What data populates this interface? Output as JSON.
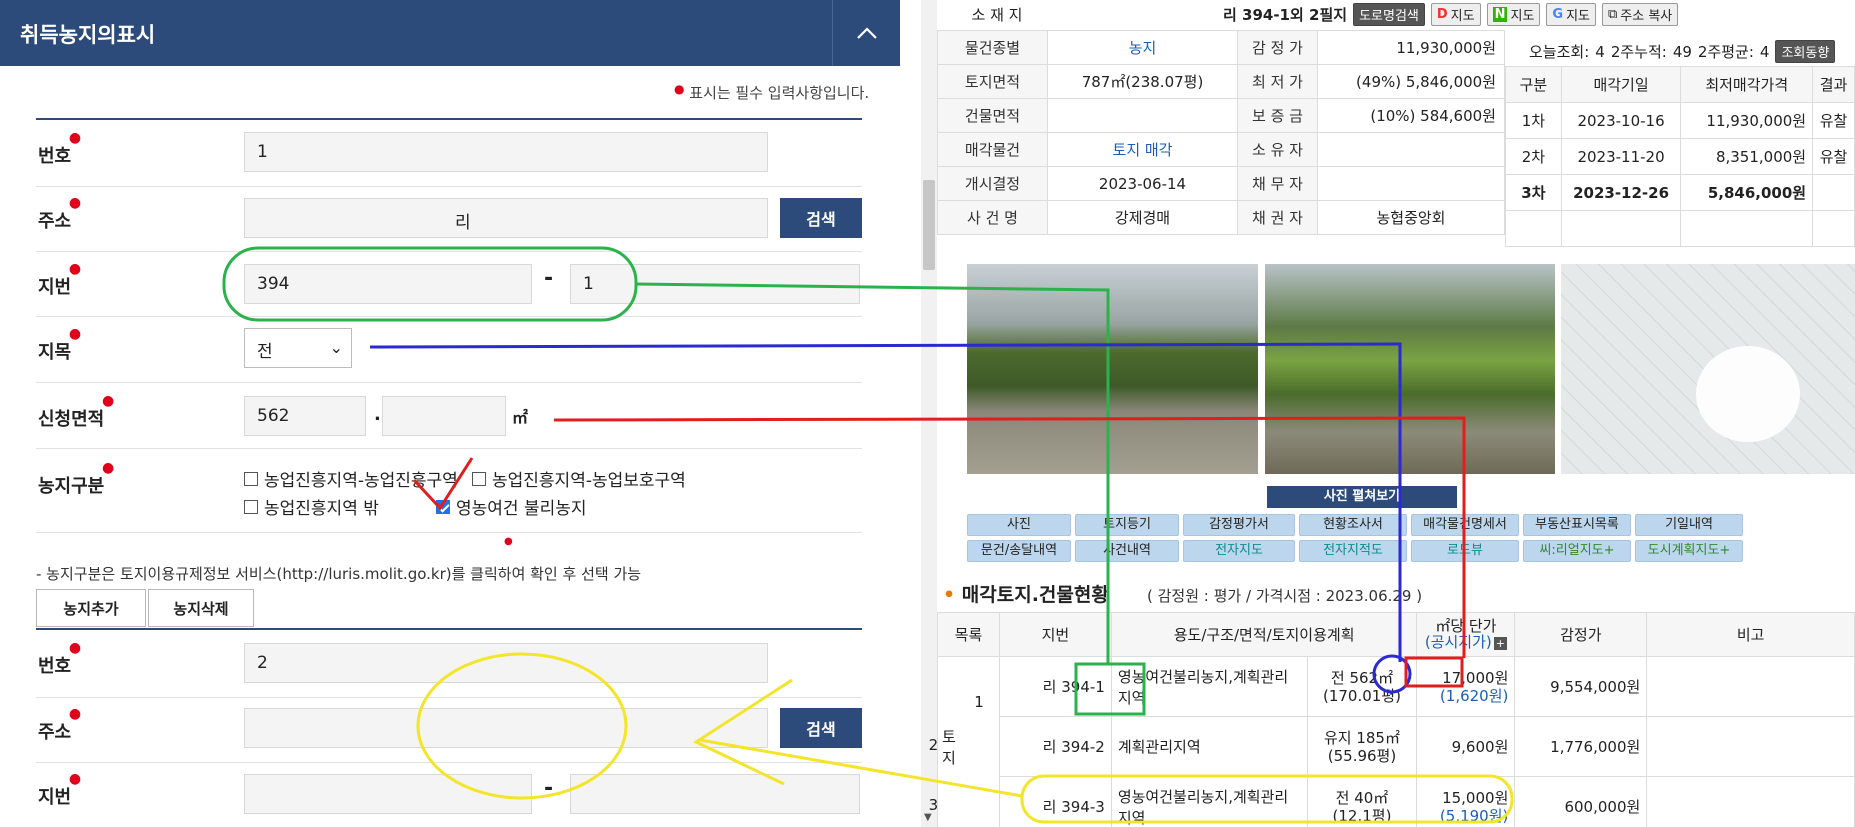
{
  "left": {
    "header_title": "취득농지의표시",
    "required_note": "표시는 필수 입력사항입니다.",
    "fields": {
      "no_label": "번호",
      "address_label": "주소",
      "lot_label": "지번",
      "category_label": "지목",
      "area_label": "신청면적",
      "zone_label": "농지구분"
    },
    "entry1": {
      "no": "1",
      "address": "리",
      "lot_main": "394",
      "lot_sub": "1",
      "category": "전",
      "area_main": "562",
      "area_sub": "",
      "area_unit": "㎡"
    },
    "search_button": "검색",
    "dash": "-",
    "dot": ".",
    "zone_options": [
      {
        "label": "농업진흥지역-농업진흥구역",
        "checked": false
      },
      {
        "label": "농업진흥지역-농업보호구역",
        "checked": false
      },
      {
        "label": "농업진흥지역 밖",
        "checked": false
      },
      {
        "label": "영농여건 불리농지",
        "checked": true
      }
    ],
    "zone_note": "- 농지구분은 토지이용규제정보 서비스(http://luris.molit.go.kr)를 클릭하여 확인 후 선택 가능",
    "add_button": "농지추가",
    "delete_button": "농지삭제",
    "entry2": {
      "no": "2",
      "address": "",
      "lot_main": "",
      "lot_sub": ""
    }
  },
  "right": {
    "address_label": "소 재 지",
    "address_value": "리 394-1외 2필지",
    "addr_buttons": [
      "도로명검색",
      "지도",
      "지도",
      "지도",
      "주소 복사"
    ],
    "info": {
      "type_label": "물건종별",
      "type_value": "농지",
      "appraisal_label": "감 정 가",
      "appraisal_value": "11,930,000원",
      "land_area_label": "토지면적",
      "land_area_value": "787㎡(238.07평)",
      "min_price_label": "최 저 가",
      "min_price_value": "(49%) 5,846,000원",
      "bldg_area_label": "건물면적",
      "bldg_area_value": "",
      "deposit_label": "보 증 금",
      "deposit_value": "(10%) 584,600원",
      "sale_item_label": "매각물건",
      "sale_item_value": "토지 매각",
      "owner_label": "소 유 자",
      "owner_value": "",
      "start_label": "개시결정",
      "start_value": "2023-06-14",
      "debtor_label": "채 무 자",
      "debtor_value": "",
      "case_label": "사 건 명",
      "case_value": "강제경매",
      "creditor_label": "채 권 자",
      "creditor_value": "농협중앙회"
    },
    "views": {
      "today_label": "오늘조회:",
      "today": "4",
      "two_week_label": "2주누적:",
      "two_week": "49",
      "avg_label": "2주평균:",
      "avg": "4",
      "trend_button": "조회동향"
    },
    "schedule_headers": [
      "구분",
      "매각기일",
      "최저매각가격",
      "결과"
    ],
    "schedule": [
      {
        "round": "1차",
        "date": "2023-10-16",
        "price": "11,930,000원",
        "result": "유찰"
      },
      {
        "round": "2차",
        "date": "2023-11-20",
        "price": "8,351,000원",
        "result": "유찰"
      },
      {
        "round": "3차",
        "date": "2023-12-26",
        "price": "5,846,000원",
        "result": ""
      }
    ],
    "photo_caption": "사진 펼쳐보기",
    "nav_row1": [
      "사진",
      "토지등기",
      "감정평가서",
      "현황조사서",
      "매각물건명세서",
      "부동산표시목록",
      "기일내역"
    ],
    "nav_row2": [
      "문건/송달내역",
      "사건내역",
      "전자지도",
      "전자지적도",
      "로드뷰",
      "씨:리얼지도+",
      "도시계획지도+"
    ],
    "section_title": "매각토지.건물현황",
    "section_sub": "( 감정원 :              평가 / 가격시점 : 2023.06.29 )",
    "land_headers": [
      "목록",
      "지번",
      "용도/구조/면적/토지이용계획",
      "㎡당 단가",
      "감정가",
      "비고"
    ],
    "unit_price_sub": "(공시지가)",
    "land_group": "토지",
    "land_rows": [
      {
        "no": "1",
        "lot": "리 394-1",
        "use": "영농여건불리농지,계획관리지역",
        "area": "전 562㎡",
        "pyeong": "(170.01평)",
        "unit": "17,000원",
        "official": "(1,620원)",
        "value": "9,554,000원"
      },
      {
        "no": "2",
        "lot": "리 394-2",
        "use": "계획관리지역",
        "area": "유지 185㎡",
        "pyeong": "(55.96평)",
        "unit": "9,600원",
        "official": "",
        "value": "1,776,000원"
      },
      {
        "no": "3",
        "lot": "리 394-3",
        "use": "영농여건불리농지,계획관리지역",
        "area": "전 40㎡",
        "pyeong": "(12.1평)",
        "unit": "15,000원",
        "official": "(5,190원)",
        "value": "600,000원"
      }
    ]
  }
}
